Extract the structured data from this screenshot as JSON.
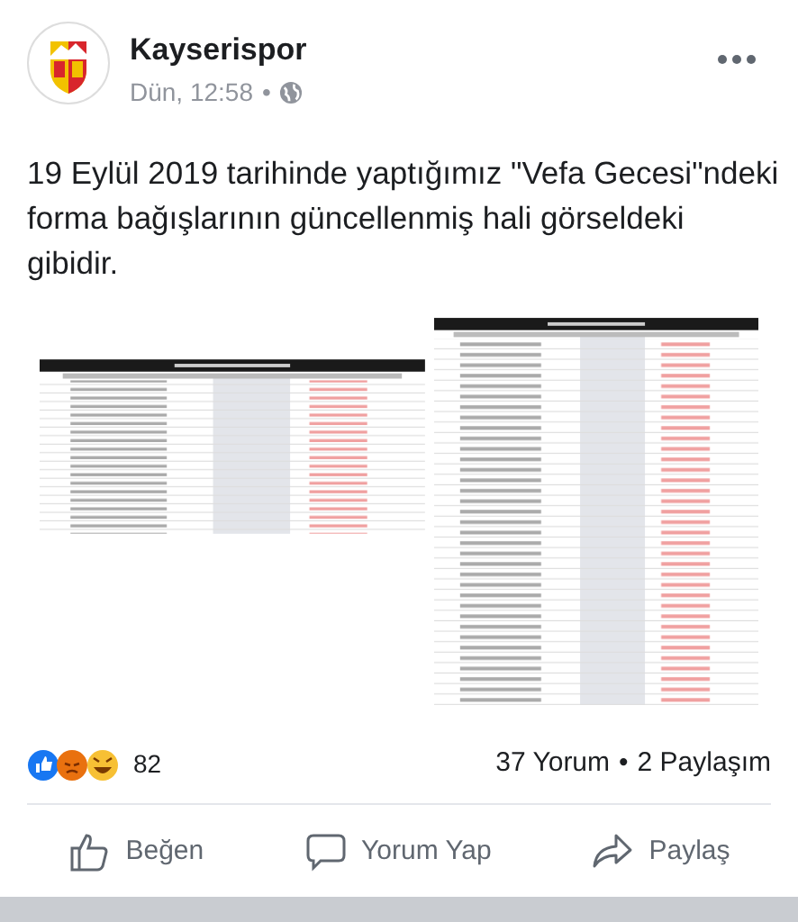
{
  "post": {
    "author": "Kayserispor",
    "time": "Dün, 12:58",
    "separator": "•",
    "text": "19 Eylül 2019 tarihinde yaptığımız \"Vefa Gecesi\"ndeki forma bağışlarının güncellenmiş hali görseldeki gibidir."
  },
  "reactions": {
    "count": "82",
    "comments": "37 Yorum",
    "separator": "•",
    "shares": "2 Paylaşım"
  },
  "actions": [
    {
      "kind": "like",
      "label": "Beğen"
    },
    {
      "kind": "comment",
      "label": "Yorum Yap"
    },
    {
      "kind": "share",
      "label": "Paylaş"
    }
  ]
}
